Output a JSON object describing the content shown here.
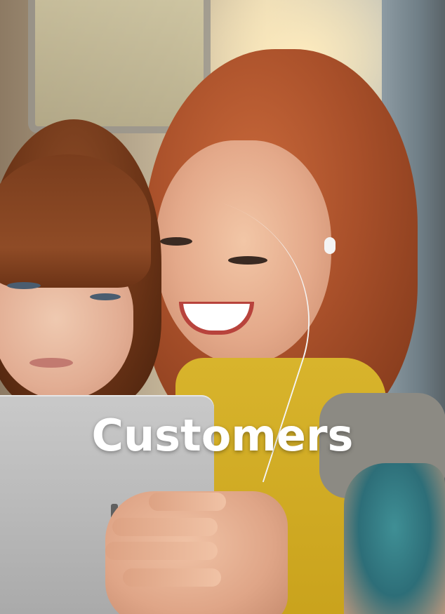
{
  "caption": {
    "text": "Customers",
    "color": "#ffffff"
  },
  "photo": {
    "icons": [
      "photo-illustration"
    ]
  }
}
